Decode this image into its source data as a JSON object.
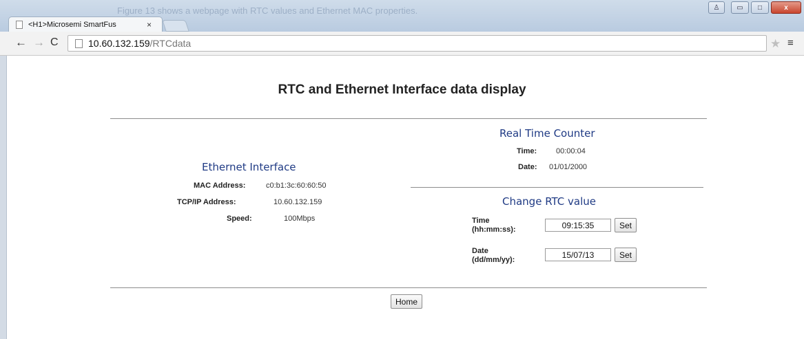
{
  "browser": {
    "ghost_caption": "Figure 13 shows a webpage with RTC values and Ethernet MAC properties.",
    "tab_title": "<H1>Microsemi SmartFus",
    "tab_close": "×",
    "url_host": "10.60.132.159",
    "url_path": "/RTCdata",
    "icons": {
      "back": "←",
      "forward": "→",
      "reload": "C",
      "star": "★",
      "menu": "≡",
      "minimize": "▭",
      "maximize": "□",
      "close": "x",
      "user": "♙"
    }
  },
  "page": {
    "title": "RTC and Ethernet Interface data display",
    "ethernet": {
      "heading": "Ethernet Interface",
      "mac_label": "MAC Address:",
      "mac_value": "c0:b1:3c:60:60:50",
      "ip_label": "TCP/IP Address:",
      "ip_value": "10.60.132.159",
      "speed_label": "Speed:",
      "speed_value": "100Mbps"
    },
    "rtc": {
      "heading": "Real Time Counter",
      "time_label": "Time:",
      "time_value": "00:00:04",
      "date_label": "Date:",
      "date_value": "01/01/2000"
    },
    "change_rtc": {
      "heading": "Change RTC value",
      "time_label_1": "Time",
      "time_label_2": "(hh:mm:ss):",
      "time_input": "09:15:35",
      "date_label_1": "Date",
      "date_label_2": "(dd/mm/yy):",
      "date_input": "15/07/13",
      "set_label": "Set"
    },
    "home_label": "Home"
  },
  "colors": {
    "heading": "#1f3a84",
    "titlebar": "#c3d3e6",
    "close_button": "#c9452e"
  }
}
